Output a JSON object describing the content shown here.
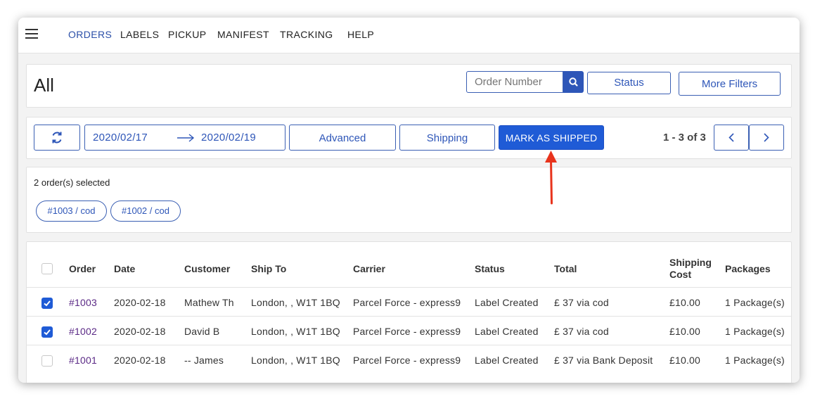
{
  "nav": {
    "items": [
      "ORDERS",
      "LABELS",
      "PICKUP",
      "MANIFEST",
      "TRACKING",
      "HELP"
    ],
    "active": "ORDERS",
    "menu_icon": "hamburger-icon"
  },
  "header": {
    "title": "All",
    "search_placeholder": "Order Number",
    "search_icon": "search-icon",
    "status_label": "Status",
    "more_filters_label": "More Filters"
  },
  "toolbar": {
    "refresh_icon": "refresh-icon",
    "date_from": "2020/02/17",
    "date_to": "2020/02/19",
    "arrow_icon": "arrow-right-icon",
    "advanced_label": "Advanced",
    "shipping_label": "Shipping",
    "mark_shipped_label": "MARK AS SHIPPED",
    "pager_text": "1 - 3 of 3",
    "prev_icon": "chevron-left-icon",
    "next_icon": "chevron-right-icon"
  },
  "selection": {
    "label": "2 order(s) selected",
    "chips": [
      "#1003 / cod",
      "#1002 / cod"
    ]
  },
  "table": {
    "columns": [
      "Order",
      "Date",
      "Customer",
      "Ship To",
      "Carrier",
      "Status",
      "Total",
      "Shipping Cost",
      "Packages"
    ],
    "shipping_cost_lines": [
      "Shipping",
      "Cost"
    ],
    "rows": [
      {
        "checked": true,
        "order": "#1003",
        "date": "2020-02-18",
        "customer": "Mathew Th",
        "ship_to": "London, , W1T 1BQ",
        "carrier": "Parcel Force - express9",
        "status": "Label Created",
        "total": "£ 37 via cod",
        "shipping_cost": "£10.00",
        "packages": "1 Package(s)"
      },
      {
        "checked": true,
        "order": "#1002",
        "date": "2020-02-18",
        "customer": "David B",
        "ship_to": "London, , W1T 1BQ",
        "carrier": "Parcel Force - express9",
        "status": "Label Created",
        "total": "£ 37 via cod",
        "shipping_cost": "£10.00",
        "packages": "1 Package(s)"
      },
      {
        "checked": false,
        "order": "#1001",
        "date": "2020-02-18",
        "customer": "-- James",
        "ship_to": "London, , W1T 1BQ",
        "carrier": "Parcel Force - express9",
        "status": "Label Created",
        "total": "£ 37 via Bank Deposit",
        "shipping_cost": "£10.00",
        "packages": "1 Package(s)"
      }
    ]
  },
  "annotation": {
    "arrow_color": "#e8331c",
    "target": "MARK AS SHIPPED"
  },
  "colors": {
    "primary": "#1f5bd6",
    "outline": "#3a5fb3",
    "order_link": "#5b2a86"
  }
}
